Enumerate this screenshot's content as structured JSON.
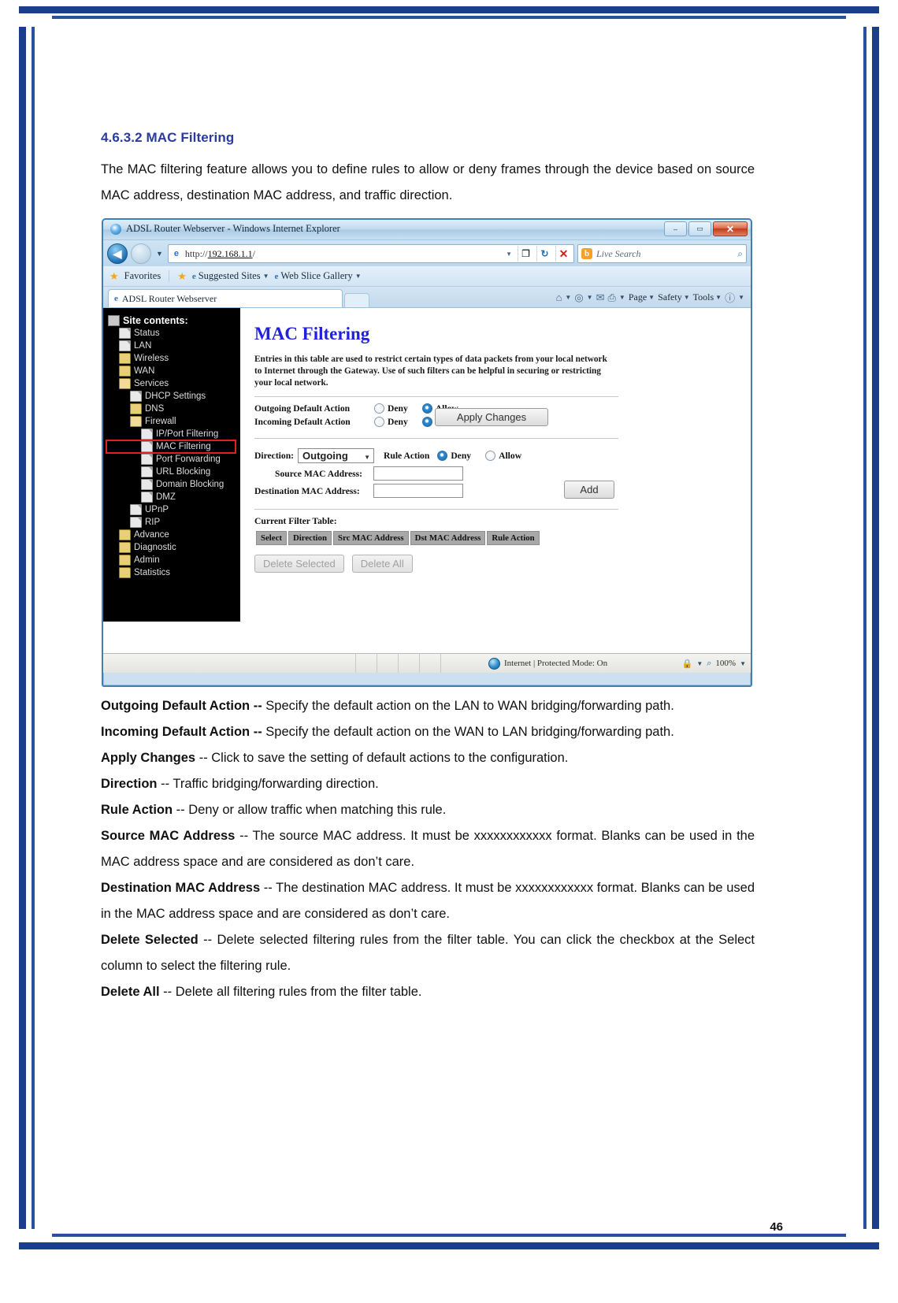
{
  "document": {
    "section_number": "4.6.3.2",
    "section_title": "4.6.3.2 MAC Filtering",
    "intro": "The MAC filtering feature allows you to define rules to allow or deny frames through the device based on source MAC address, destination MAC address, and traffic direction.",
    "page_number": "46"
  },
  "browser": {
    "window_title": "ADSL Router Webserver - Windows Internet Explorer",
    "minimize_label": "–",
    "maximize_label": "▭",
    "close_label": "✕",
    "back_label": "◀",
    "forward_label": "",
    "nav_dropdown": "▼",
    "url": "http://192.168.1.1/",
    "url_host": "192.168.1.1",
    "url_prefix": "http://",
    "url_suffix": "/",
    "url_dropdown": "▼",
    "compat_label": "❐",
    "refresh_label": "↻",
    "stop_label": "✕",
    "search_engine": "Live Search",
    "search_engine_icon": "b",
    "search_go": "⌕",
    "favorites_label": "Favorites",
    "suggested_sites_label": "Suggested Sites",
    "web_slice_label": "Web Slice Gallery",
    "tab_title": "ADSL Router Webserver",
    "command_bar": [
      "Page",
      "Safety",
      "Tools"
    ],
    "status_zone": "Internet | Protected Mode: On",
    "zoom_level": "100%"
  },
  "sitetree": {
    "root": "Site contents:",
    "items": [
      {
        "label": "Status",
        "icon": "file-icon",
        "indent": 1
      },
      {
        "label": "LAN",
        "icon": "file-icon",
        "indent": 1
      },
      {
        "label": "Wireless",
        "icon": "folder-icon",
        "indent": 1
      },
      {
        "label": "WAN",
        "icon": "folder-icon",
        "indent": 1
      },
      {
        "label": "Services",
        "icon": "folder-open-icon",
        "indent": 1
      },
      {
        "label": "DHCP Settings",
        "icon": "file-icon",
        "indent": 2
      },
      {
        "label": "DNS",
        "icon": "folder-icon",
        "indent": 2
      },
      {
        "label": "Firewall",
        "icon": "folder-open-icon",
        "indent": 2
      },
      {
        "label": "IP/Port Filtering",
        "icon": "file-icon",
        "indent": 3
      },
      {
        "label": "MAC Filtering",
        "icon": "file-icon",
        "indent": 3,
        "selected": true
      },
      {
        "label": "Port Forwarding",
        "icon": "file-icon",
        "indent": 3
      },
      {
        "label": "URL Blocking",
        "icon": "file-icon",
        "indent": 3
      },
      {
        "label": "Domain Blocking",
        "icon": "file-icon",
        "indent": 3
      },
      {
        "label": "DMZ",
        "icon": "file-icon",
        "indent": 3
      },
      {
        "label": "UPnP",
        "icon": "file-icon",
        "indent": 2
      },
      {
        "label": "RIP",
        "icon": "file-icon",
        "indent": 2
      },
      {
        "label": "Advance",
        "icon": "folder-icon",
        "indent": 1
      },
      {
        "label": "Diagnostic",
        "icon": "folder-icon",
        "indent": 1
      },
      {
        "label": "Admin",
        "icon": "folder-icon",
        "indent": 1
      },
      {
        "label": "Statistics",
        "icon": "folder-icon",
        "indent": 1
      }
    ]
  },
  "routerpage": {
    "title": "MAC Filtering",
    "description": "Entries in this table are used to restrict certain types of data packets from your local network to Internet through the Gateway. Use of such filters can be helpful in securing or restricting your local network.",
    "outgoing_label": "Outgoing Default Action",
    "incoming_label": "Incoming Default Action",
    "deny_label": "Deny",
    "allow_label": "Allow",
    "outgoing_selected": "Allow",
    "incoming_selected": "Allow",
    "apply_label": "Apply Changes",
    "direction_label": "Direction:",
    "direction_value": "Outgoing",
    "direction_caret": "▼",
    "rule_action_label": "Rule Action",
    "rule_action_selected": "Deny",
    "src_mac_label": "Source MAC Address:",
    "src_mac_value": "",
    "dst_mac_label": "Destination MAC Address:",
    "dst_mac_value": "",
    "add_label": "Add",
    "filter_table_label": "Current Filter Table:",
    "filter_table_headers": [
      "Select",
      "Direction",
      "Src MAC Address",
      "Dst MAC Address",
      "Rule Action"
    ],
    "filter_table_rows": [],
    "delete_selected_label": "Delete Selected",
    "delete_all_label": "Delete All"
  },
  "definitions": [
    {
      "term": "Outgoing Default Action --",
      "text": " Specify the default action on the LAN to WAN bridging/forwarding path."
    },
    {
      "term": "Incoming Default Action --",
      "text": " Specify the default action on the WAN to LAN bridging/forwarding path."
    },
    {
      "term": "Apply Changes",
      "text": " -- Click to save the setting of default actions to the configuration."
    },
    {
      "term": "Direction",
      "text": " -- Traffic bridging/forwarding direction."
    },
    {
      "term": "Rule Action",
      "text": " -- Deny or allow traffic when matching this rule."
    },
    {
      "term": "Source MAC Address",
      "text": " -- The source MAC address. It must be xxxxxxxxxxxx format. Blanks can be used in the MAC address space and are considered as don’t care."
    },
    {
      "term": "Destination MAC Address",
      "text": " -- The destination MAC address. It must be xxxxxxxxxxxx format. Blanks can be used in the MAC address space and are considered as don’t care."
    },
    {
      "term": "Delete Selected",
      "text": " -- Delete selected filtering rules from the filter table. You can click the checkbox at the Select column to select the filtering rule."
    },
    {
      "term": "Delete All",
      "text": " -- Delete all filtering rules from the filter table."
    }
  ],
  "colors": {
    "heading": "#2a3a9e",
    "router_title": "#2020dd",
    "frame": "#1b3e8c",
    "selection_outline": "#e02020"
  }
}
